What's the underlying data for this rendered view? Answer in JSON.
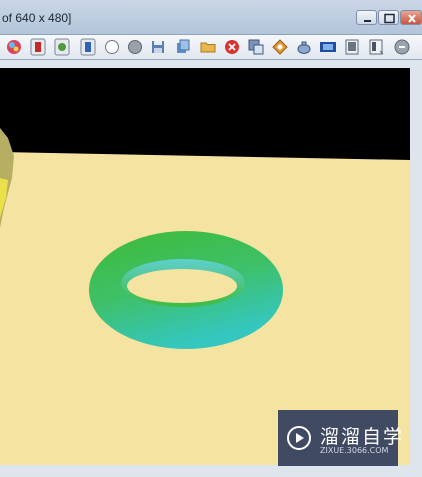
{
  "window": {
    "title": "of 640 x 480]"
  },
  "toolbar": {
    "buttons": [
      {
        "icon": "shaded-sphere-icon"
      },
      {
        "icon": "red-mode-icon"
      },
      {
        "icon": "green-mode-icon"
      },
      {
        "icon": "blue-mode-icon"
      },
      {
        "icon": "white-sphere-icon"
      },
      {
        "icon": "gray-sphere-icon"
      },
      {
        "icon": "save-icon"
      },
      {
        "icon": "copy-icon"
      },
      {
        "icon": "open-folder-icon"
      },
      {
        "icon": "stop-render-icon"
      },
      {
        "icon": "clone-icon"
      },
      {
        "icon": "region-render-icon"
      },
      {
        "icon": "teapot-icon"
      },
      {
        "icon": "film-icon"
      },
      {
        "icon": "display-icon"
      },
      {
        "icon": "panel-icon"
      },
      {
        "icon": "stop-icon"
      }
    ]
  },
  "watermark": {
    "title": "溜溜自学",
    "url": "ZIXUE.3066.COM"
  },
  "colors": {
    "floor": "#f5e3a1",
    "torus_outer": "#3bbb3c",
    "torus_inner": "#37c7b8",
    "background": "#000000"
  }
}
